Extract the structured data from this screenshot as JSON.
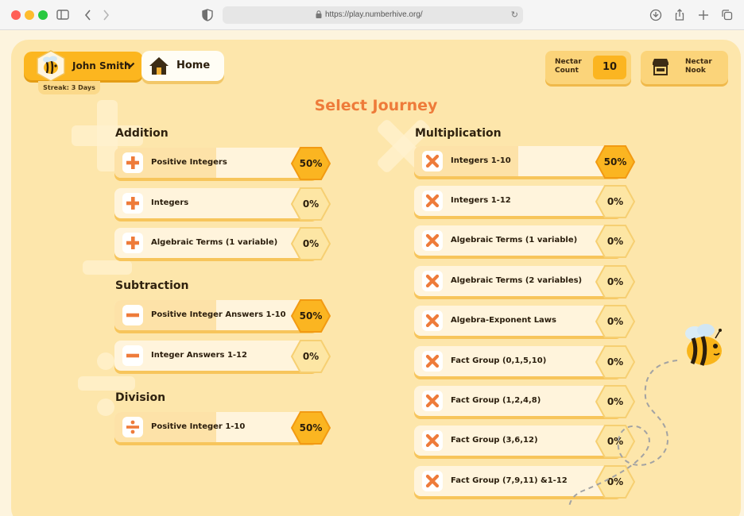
{
  "browser": {
    "url": "https://play.numberhive.org/",
    "colors": {
      "close": "#ff5f57",
      "minimize": "#febc2e",
      "maximize": "#28c840"
    }
  },
  "header": {
    "user_name": "John Smith",
    "streak": "Streak: 3 Days",
    "home_label": "Home",
    "nectar_count_label_1": "Nectar",
    "nectar_count_label_2": "Count",
    "nectar_count_value": "10",
    "nectar_nook_label_1": "Nectar",
    "nectar_nook_label_2": "Nook"
  },
  "page_title": "Select Journey",
  "colors": {
    "accent": "#ee7b3a",
    "honey": "#fcb61f",
    "panel": "#fde6ab",
    "progress_fill": "#fde2a8",
    "track": "#fff4dc"
  },
  "sections": {
    "addition": {
      "title": "Addition",
      "items": [
        {
          "label": "Positive Integers",
          "progress": "50%",
          "icon": "plus-icon",
          "fill": 0.5
        },
        {
          "label": "Integers",
          "progress": "0%",
          "icon": "plus-icon",
          "fill": 0
        },
        {
          "label": "Algebraic Terms (1 variable)",
          "progress": "0%",
          "icon": "plus-icon",
          "fill": 0
        }
      ]
    },
    "subtraction": {
      "title": "Subtraction",
      "items": [
        {
          "label": "Positive Integer Answers 1-10",
          "progress": "50%",
          "icon": "minus-icon",
          "fill": 0.5
        },
        {
          "label": "Integer Answers 1-12",
          "progress": "0%",
          "icon": "minus-icon",
          "fill": 0
        }
      ]
    },
    "division": {
      "title": "Division",
      "items": [
        {
          "label": "Positive Integer 1-10",
          "progress": "50%",
          "icon": "divide-icon",
          "fill": 0.5
        }
      ]
    },
    "multiplication": {
      "title": "Multiplication",
      "items": [
        {
          "label": "Integers 1-10",
          "progress": "50%",
          "icon": "times-icon",
          "fill": 0.5
        },
        {
          "label": "Integers 1-12",
          "progress": "0%",
          "icon": "times-icon",
          "fill": 0
        },
        {
          "label": "Algebraic Terms (1 variable)",
          "progress": "0%",
          "icon": "times-icon",
          "fill": 0
        },
        {
          "label": "Algebraic Terms (2 variables)",
          "progress": "0%",
          "icon": "times-icon",
          "fill": 0
        },
        {
          "label": "Algebra-Exponent Laws",
          "progress": "0%",
          "icon": "times-icon",
          "fill": 0
        },
        {
          "label": "Fact Group (0,1,5,10)",
          "progress": "0%",
          "icon": "times-icon",
          "fill": 0
        },
        {
          "label": "Fact Group (1,2,4,8)",
          "progress": "0%",
          "icon": "times-icon",
          "fill": 0
        },
        {
          "label": "Fact Group (3,6,12)",
          "progress": "0%",
          "icon": "times-icon",
          "fill": 0
        },
        {
          "label": "Fact Group (7,9,11) &1-12",
          "progress": "0%",
          "icon": "times-icon",
          "fill": 0
        }
      ]
    }
  }
}
